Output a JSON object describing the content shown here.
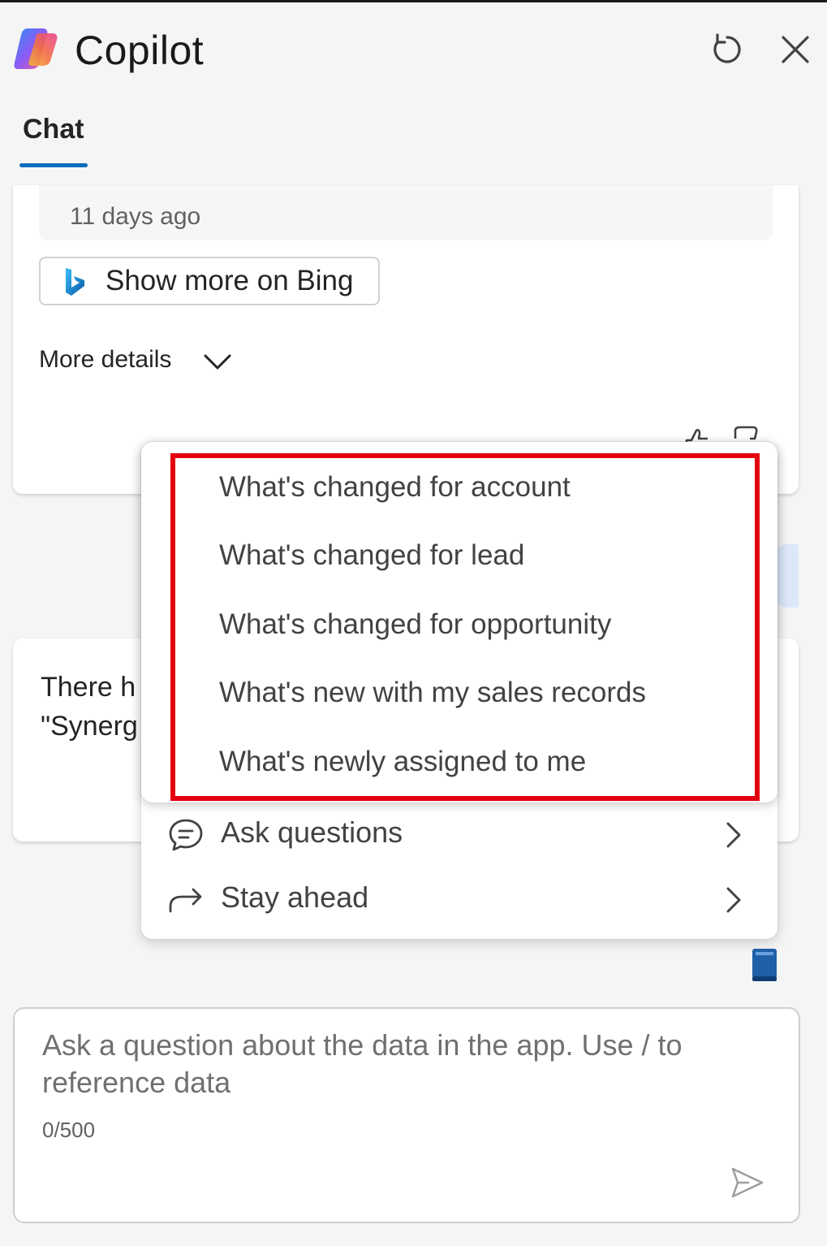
{
  "app": {
    "title": "Copilot"
  },
  "header": {
    "refresh_icon": "refresh-icon",
    "close_icon": "close-icon"
  },
  "tabs": [
    {
      "label": "Chat",
      "active": true
    }
  ],
  "card_1": {
    "snippet_time": "11 days ago",
    "bing_button_label": "Show more on Bing",
    "more_details_label": "More details"
  },
  "card_2": {
    "text_line_1": "There h",
    "text_line_2": "\"Synerg"
  },
  "prompt_menu": {
    "submenu_items": [
      "What's changed for account",
      "What's changed for lead",
      "What's changed for opportunity",
      "What's new with my sales records",
      "What's newly assigned to me"
    ],
    "items": [
      {
        "label": "Ask questions",
        "icon": "chat-bubble-icon"
      },
      {
        "label": "Stay ahead",
        "icon": "share-arrow-icon"
      }
    ]
  },
  "composer": {
    "placeholder": "Ask a question about the data in the app. Use / to reference data",
    "counter": "0/500"
  },
  "colors": {
    "accent": "#0f6cbd",
    "highlight_border": "#e3000f",
    "background": "#f5f5f5"
  }
}
